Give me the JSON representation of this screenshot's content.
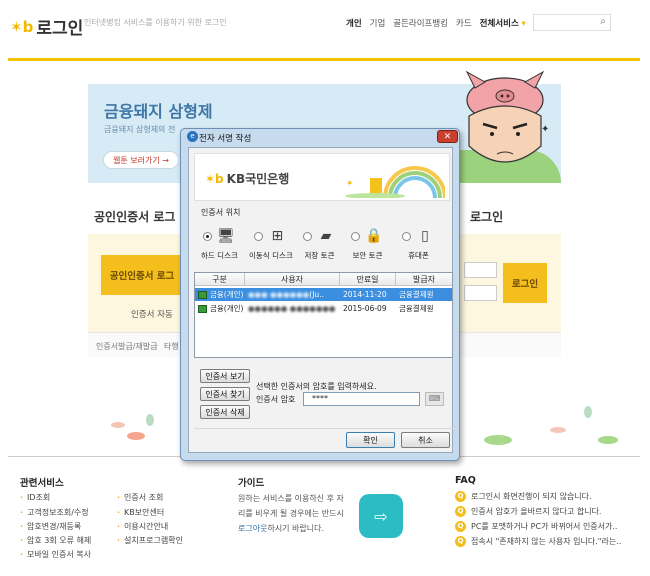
{
  "header": {
    "logo_text": "로그인",
    "tagline": "인터넷뱅킹 서비스를 이용하기 위한 로그인",
    "nav": [
      "개인",
      "기업",
      "골든라이프뱅킹",
      "카드",
      "전체서비스"
    ],
    "search_placeholder": ""
  },
  "banner": {
    "title": "금융돼지 삼형제",
    "subtitle": "금융돼지 삼형제의 전",
    "button": "웹툰 보러가기 →"
  },
  "cert_section": {
    "title": "공인인증서 로그",
    "button": "공인인증서 로그",
    "auto_text": "인증서 자동 ",
    "footer_links": [
      "인증서발급/재발급",
      "타행"
    ]
  },
  "login_section": {
    "title": "로그인",
    "button": "로그인"
  },
  "footer": {
    "related": {
      "title": "관련서비스",
      "col1": [
        "ID조회",
        "고객정보조회/수정",
        "암호변경/재등록",
        "암호 3회 오류 해제",
        "모바일 인증서 복사"
      ],
      "col2": [
        "인증서 조회",
        "KB보안센터",
        "이용시간안내",
        "설치프로그램확인"
      ]
    },
    "guide": {
      "title": "가이드",
      "text_pre": "원하는 서비스를 이용하신 후 자리를 비우게 될 경우에는 반드시 ",
      "link": "로그아웃",
      "text_post": "하시기 바랍니다."
    },
    "faq": {
      "title": "FAQ",
      "items": [
        "로그인시 화면진행이 되지 않습니다.",
        "인증서 암호가 올바르지 않다고 합니다.",
        "PC를 포맷하거나 PC가 바뀌어서 인증서가..",
        "접속시 \"존재하지 않는 사용자 입니다.\"라는.."
      ]
    }
  },
  "dialog": {
    "title": "전자 서명 작성",
    "close": "✕",
    "bank_name": "KB국민은행",
    "location_label": "인증서 위치",
    "locations": [
      {
        "label": "하드 디스크",
        "icon": "monitor-icon",
        "glyph": "🖥",
        "selected": true
      },
      {
        "label": "이동식 디스크",
        "icon": "removable-disk-icon",
        "glyph": "⊞",
        "selected": false
      },
      {
        "label": "저장 토큰",
        "icon": "storage-token-icon",
        "glyph": "▰",
        "selected": false
      },
      {
        "label": "보안 토큰",
        "icon": "security-token-icon",
        "glyph": "🔒",
        "selected": false
      },
      {
        "label": "휴대폰",
        "icon": "phone-icon",
        "glyph": "▯",
        "selected": false
      }
    ],
    "table": {
      "columns": [
        "구분",
        "사용자",
        "만료일",
        "발급자"
      ],
      "rows": [
        {
          "type": "금융(개인)",
          "user": "(Ju..",
          "expiry": "2014-11-20",
          "issuer": "금융결제원",
          "selected": true
        },
        {
          "type": "금융(개인)",
          "user": "",
          "expiry": "2015-06-09",
          "issuer": "금융결제원",
          "selected": false
        }
      ]
    },
    "buttons": {
      "view": "인증서 보기",
      "find": "인증서 찾기",
      "delete": "인증서 삭제",
      "ok": "확인",
      "cancel": "취소"
    },
    "pw_prompt": "선택한 인증서의 암호를 입력하세요.",
    "pw_label": "인증서 암호",
    "pw_value": "****"
  }
}
